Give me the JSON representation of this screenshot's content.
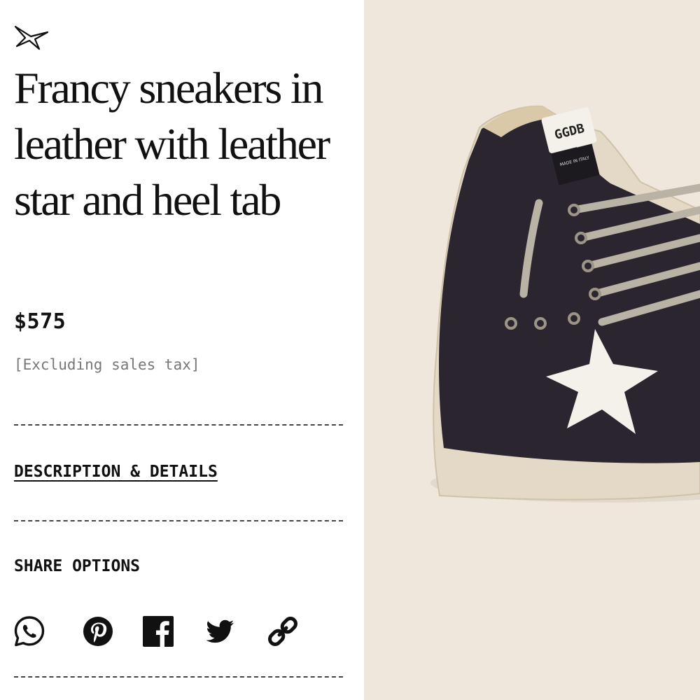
{
  "logo": {
    "icon": "star-outline-icon"
  },
  "product": {
    "title": "Francy sneakers in leather with leather star and heel tab",
    "price": "$575",
    "tax_note": "[Excluding sales tax]"
  },
  "details": {
    "link_label": "DESCRIPTION & DETAILS"
  },
  "share": {
    "title": "SHARE OPTIONS",
    "icons": [
      "whatsapp-icon",
      "pinterest-icon",
      "facebook-icon",
      "twitter-icon",
      "link-icon"
    ]
  },
  "image": {
    "alt": "Francy sneaker photo",
    "label_text": "GGDB",
    "label_subtext": "MADE IN ITALY",
    "colors": {
      "background": "#efe7dc",
      "suede": "#2b2530",
      "star": "#f4f0ea",
      "laces": "#b9b3a5",
      "sole": "#e3d9c6"
    }
  }
}
